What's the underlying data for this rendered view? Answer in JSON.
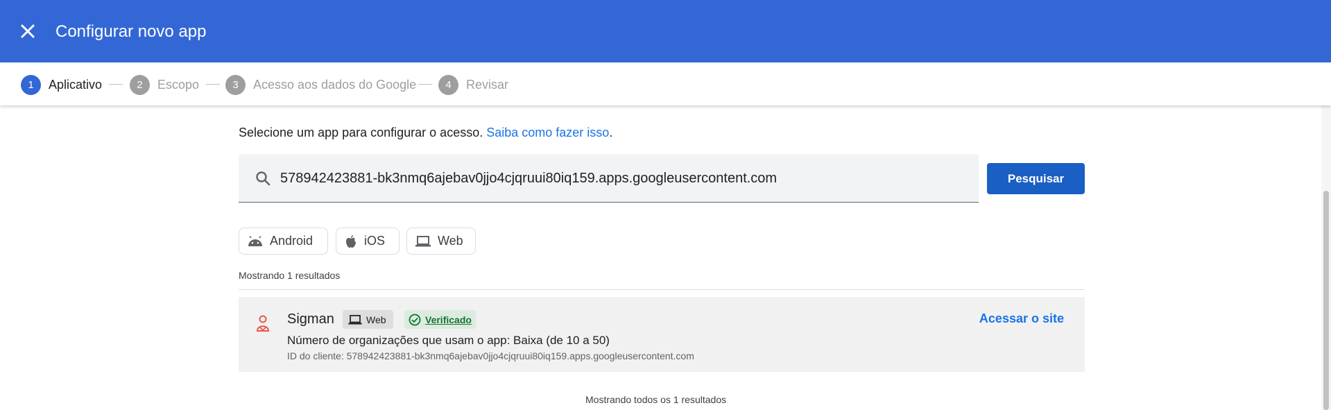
{
  "header": {
    "title": "Configurar novo app",
    "close_icon": "close-icon",
    "bg_color": "#3367d6"
  },
  "stepper": {
    "steps": [
      {
        "number": "1",
        "label": "Aplicativo",
        "active": true
      },
      {
        "number": "2",
        "label": "Escopo",
        "active": false
      },
      {
        "number": "3",
        "label": "Acesso aos dados do Google",
        "active": false
      },
      {
        "number": "4",
        "label": "Revisar",
        "active": false
      }
    ]
  },
  "main": {
    "intro_text": "Selecione um app para configurar o acesso. ",
    "intro_link": "Saiba como fazer isso",
    "intro_end": ".",
    "search": {
      "value": "578942423881-bk3nmq6ajebav0jjo4cjqruui80iq159.apps.googleusercontent.com",
      "button_label": "Pesquisar"
    },
    "filters": [
      {
        "label": "Android",
        "icon": "android-icon"
      },
      {
        "label": "iOS",
        "icon": "apple-icon"
      },
      {
        "label": "Web",
        "icon": "laptop-icon"
      }
    ],
    "results_count": "Mostrando 1 resultados",
    "result": {
      "name": "Sigman",
      "platform_badge": "Web",
      "verified_badge": "Verificado",
      "orgs_text": "Número de organizações que usam o app: Baixa (de 10 a 50)",
      "client_id": "ID do cliente: 578942423881-bk3nmq6ajebav0jjo4cjqruui80iq159.apps.googleusercontent.com",
      "visit_link": "Acessar o site"
    },
    "results_footer": "Mostrando todos os 1 resultados"
  },
  "colors": {
    "accent": "#3367d6",
    "button": "#1a5fc4",
    "link": "#1a73e8",
    "verified": "#137333"
  }
}
